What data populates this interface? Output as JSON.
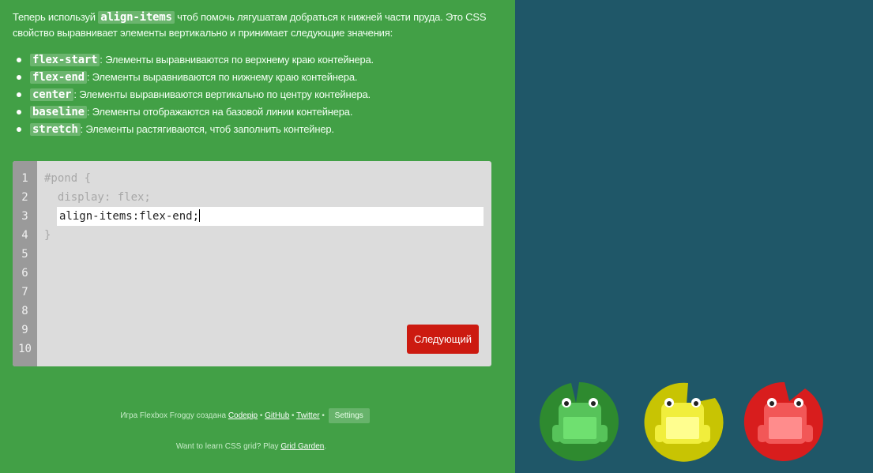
{
  "instructions": {
    "part1": "Теперь используй ",
    "code": "align-items",
    "part2": " чтоб помочь лягушатам добраться к нижней части пруда. Это CSS свойство выравнивает элементы вертикально и принимает следующие значения:"
  },
  "values": [
    {
      "code": "flex-start",
      "text": ": Элементы выравниваются по верхнему краю контейнера."
    },
    {
      "code": "flex-end",
      "text": ": Элементы выравниваются по нижнему краю контейнера."
    },
    {
      "code": "center",
      "text": ": Элементы выравниваются вертикально по центру контейнера."
    },
    {
      "code": "baseline",
      "text": ": Элементы отображаются на базовой линии контейнера."
    },
    {
      "code": "stretch",
      "text": ": Элементы растягиваются, чтоб заполнить контейнер."
    }
  ],
  "editor": {
    "line_numbers": [
      "1",
      "2",
      "3",
      "4",
      "5",
      "6",
      "7",
      "8",
      "9",
      "10"
    ],
    "line1": "#pond {",
    "line2": "  display: flex;",
    "input_value": "align-items:flex-end;",
    "line4": "}"
  },
  "next_button": "Следующий",
  "footer": {
    "prefix": "Игра Flexbox Froggy создана ",
    "codepip": "Codepip",
    "sep": " • ",
    "github": "GitHub",
    "twitter": "Twitter",
    "settings": "Settings"
  },
  "footer2": {
    "prefix": "Want to learn CSS grid? Play ",
    "link": "Grid Garden",
    "suffix": "."
  },
  "frogs": [
    {
      "color": "green",
      "pad": "#2e8a2f",
      "body": "#57c35a",
      "face": "#6fe070"
    },
    {
      "color": "yellow",
      "pad": "#c8c403",
      "body": "#f1ee3c",
      "face": "#fffe8f"
    },
    {
      "color": "red",
      "pad": "#d81d1d",
      "body": "#f25757",
      "face": "#ff8c8c"
    }
  ]
}
